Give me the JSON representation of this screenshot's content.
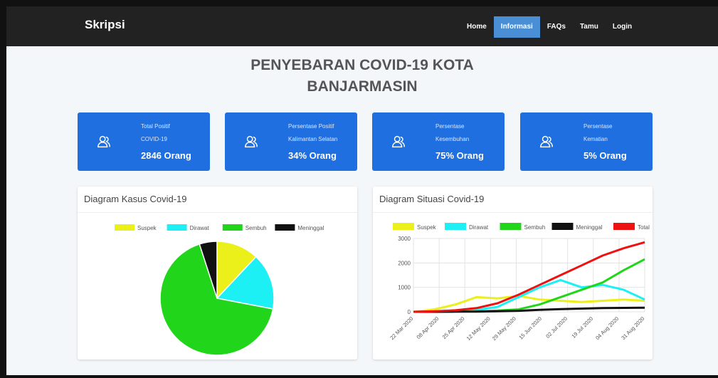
{
  "navbar": {
    "brand": "Skripsi",
    "items": [
      "Home",
      "Informasi",
      "FAQs",
      "Tamu",
      "Login"
    ]
  },
  "page_title_line1": "PENYEBARAN COVID-19 KOTA",
  "page_title_line2": "BANJARMASIN",
  "cards": [
    {
      "line1": "Total Positif",
      "line2": "COVID-19",
      "value": "2846 Orang",
      "icon": "user-group-icon"
    },
    {
      "line1": "Persentase Positif",
      "line2": "Kalimantan Selatan",
      "value": "34% Orang",
      "icon": "user-group-icon"
    },
    {
      "line1": "Persentase",
      "line2": "Kesembuhan",
      "value": "75% Orang",
      "icon": "user-group-icon"
    },
    {
      "line1": "Persentase",
      "line2": "Kematian",
      "value": "5% Orang",
      "icon": "user-group-icon"
    }
  ],
  "panels": {
    "pie_title": "Diagram Kasus Covid-19",
    "line_title": "Diagram Situasi Covid-19"
  },
  "colors": {
    "navbar": "#222222",
    "active_nav": "#4a8fd6",
    "card": "#1f6fe0"
  },
  "chart_data": [
    {
      "type": "pie",
      "title": "",
      "legend_position": "top",
      "labels": [
        "Suspek",
        "Dirawat",
        "Sembuh",
        "Meninggal"
      ],
      "colors": [
        "#ecf01a",
        "#1cf0f5",
        "#21d61a",
        "#111111"
      ],
      "values": [
        12,
        16,
        67,
        5
      ]
    },
    {
      "type": "line",
      "title": "",
      "legend_position": "top",
      "grid": true,
      "x_ticks": [
        "22 Mar 2020",
        "08 Apr 2020",
        "25 Apr 2020",
        "12 May 2020",
        "29 May 2020",
        "15 Jun 2020",
        "02 Jul 2020",
        "19 Jul 2020",
        "04 Aug 2020",
        "31 Aug 2020"
      ],
      "y_ticks": [
        0,
        1000,
        2000,
        3000
      ],
      "ylim": [
        0,
        3000
      ],
      "series": [
        {
          "name": "Suspek",
          "color": "#ecf01a",
          "values": [
            0,
            100,
            300,
            600,
            550,
            650,
            500,
            450,
            400,
            450,
            500,
            450
          ]
        },
        {
          "name": "Dirawat",
          "color": "#1cf0f5",
          "values": [
            0,
            20,
            40,
            80,
            200,
            600,
            1000,
            1300,
            1000,
            1100,
            900,
            500
          ]
        },
        {
          "name": "Sembuh",
          "color": "#21d61a",
          "values": [
            0,
            0,
            10,
            20,
            50,
            100,
            300,
            600,
            900,
            1200,
            1700,
            2150
          ]
        },
        {
          "name": "Meninggal",
          "color": "#111111",
          "values": [
            0,
            0,
            5,
            10,
            20,
            40,
            80,
            110,
            130,
            150,
            160,
            170
          ]
        },
        {
          "name": "Total",
          "color": "#ee1111",
          "values": [
            0,
            20,
            60,
            150,
            350,
            700,
            1100,
            1500,
            1900,
            2300,
            2600,
            2846
          ]
        }
      ]
    }
  ]
}
